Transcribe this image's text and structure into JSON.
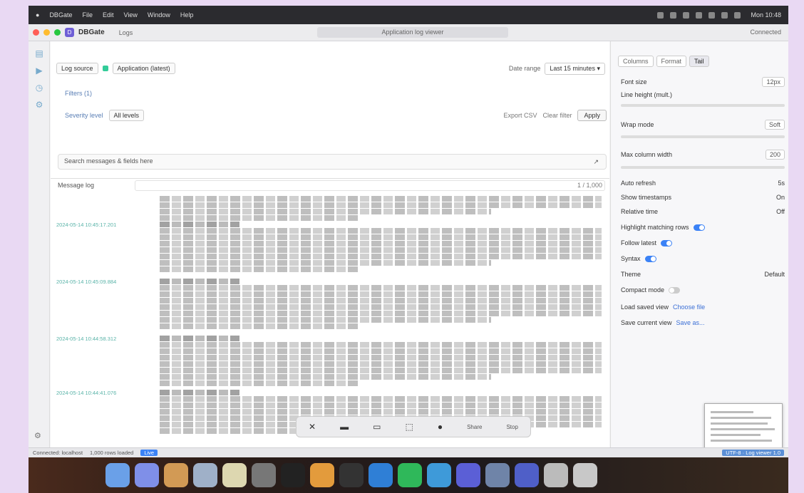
{
  "menubar": {
    "app_menu": [
      "DBGate",
      "File",
      "Edit",
      "View",
      "Window",
      "Help"
    ],
    "clock": "Mon 10:48"
  },
  "window": {
    "app_name": "DBGate",
    "tab_label": "Logs",
    "center_title": "Application log viewer",
    "right_status": "Connected"
  },
  "toolbar": {
    "source_label": "Log source",
    "source_value": "Application (latest)",
    "date_range_label": "Date range",
    "date_range_value": "Last 15 minutes"
  },
  "filter_row": {
    "breadcrumb": "Filters (1)",
    "field_label": "Severity level",
    "field_value": "All levels",
    "btn_export": "Export CSV",
    "btn_clear": "Clear filter",
    "btn_apply": "Apply"
  },
  "query": {
    "text": "Search messages & fields here"
  },
  "logs": {
    "header": "Message log",
    "count": "1 / 1,000",
    "entries": [
      {
        "ts": ""
      },
      {
        "ts": "2024-05-14 10:45:17.201"
      },
      {
        "ts": "2024-05-14 10:45:09.884"
      },
      {
        "ts": "2024-05-14 10:44:58.312"
      },
      {
        "ts": "2024-05-14 10:44:41.076"
      }
    ]
  },
  "floatbar": {
    "btn_share": "Share",
    "btn_stop": "Stop"
  },
  "sidebar": {
    "tabs": [
      "Columns",
      "Format",
      "Tail"
    ],
    "font_size_label": "Font size",
    "font_size_value": "12px",
    "line_height_label": "Line height (mult.)",
    "wrap_label": "Wrap mode",
    "wrap_value": "Soft",
    "max_width_label": "Max column width",
    "max_width_value": "200",
    "r1_label": "Auto refresh",
    "r1_value": "5s",
    "r2_label": "Show timestamps",
    "r2_value": "On",
    "r3_label": "Relative time",
    "r3_value": "Off",
    "t1_label": "Highlight matching rows",
    "t2_label": "Follow latest",
    "t3_label": "Syntax",
    "theme_label": "Theme",
    "theme_value": "Default",
    "t4_label": "Compact mode",
    "link1_label": "Load saved view",
    "link1_value": "Choose file",
    "link2_label": "Save current view",
    "link2_value": "Save as..."
  },
  "statusbar": {
    "left_text": "Connected: localhost",
    "mid_text": "1,000 rows loaded",
    "tag": "Live",
    "right_tag": "UTF-8 · Log viewer 1.0"
  },
  "colors": {
    "accent": "#3b82f6",
    "timestamp": "#59b3a8",
    "desktop_bg": "#e9d9f3"
  }
}
